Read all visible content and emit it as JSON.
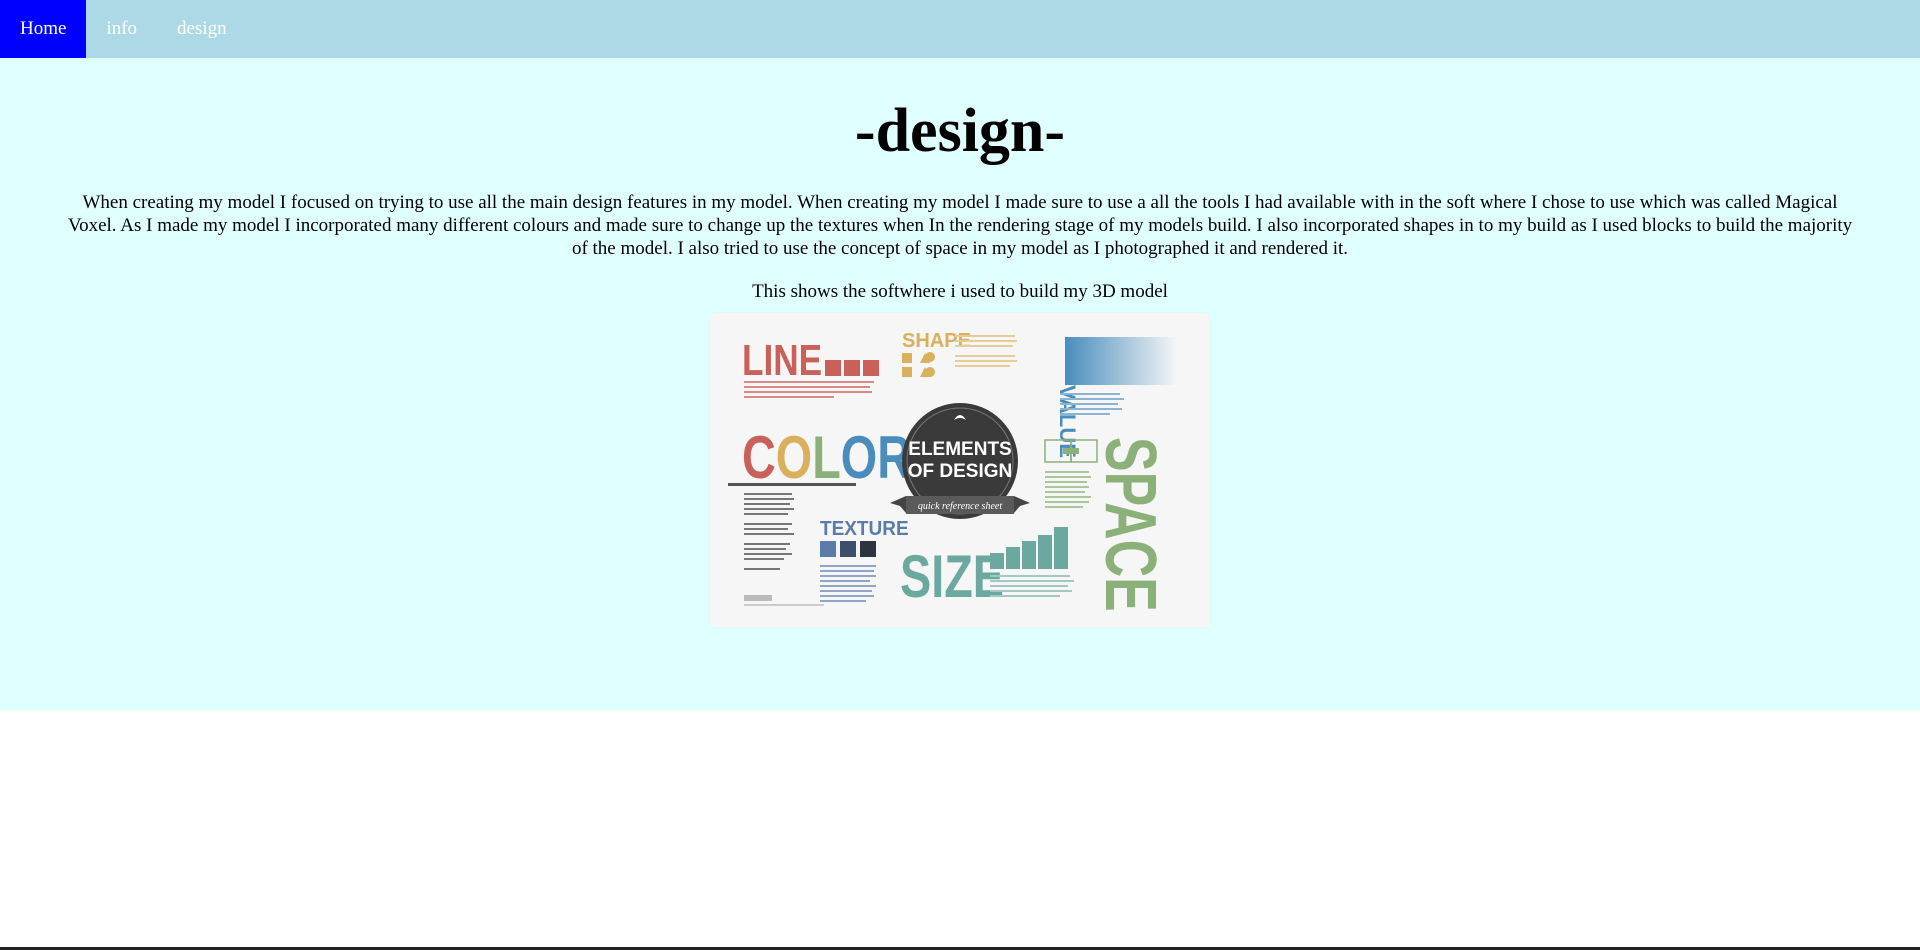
{
  "nav": {
    "items": [
      "Home",
      "info",
      "design"
    ],
    "active_index": 0
  },
  "main": {
    "title": "-design-",
    "paragraph": "When creating my model I focused on trying to use all the main design features in my model. When creating my model I made sure to use a all the tools I had available with in the soft where I chose to use which was called Magical Voxel. As I made my model I incorporated many different colours and made sure to change up the textures when In the rendering stage of my models build. I also incorporated shapes in to my build as I used blocks to build the majority of the model. I also tried to use the concept of space in my model as I photographed it and rendered it.",
    "image_caption": "This shows the softwhere i used to build my 3D model"
  },
  "poster": {
    "labels": {
      "line": "LINE",
      "shape": "SHAPE",
      "value": "VALUE",
      "color": "COLOR",
      "badge_line1": "ELEMENTS",
      "badge_line2": "OF DESIGN",
      "ribbon": "quick reference sheet",
      "texture": "TEXTURE",
      "size": "SIZE",
      "space": "SPACE"
    },
    "colors": {
      "line": "#c9605a",
      "shape": "#d9b05c",
      "value": "#4a8dbd",
      "color_c": "#c9605a",
      "color_o1": "#d9b05c",
      "color_l": "#8bb07a",
      "color_o2": "#4a8dbd",
      "color_r": "#4a8dbd",
      "badge": "#3a3a3a",
      "texture": "#5b7ba8",
      "size": "#6aa8a0",
      "space": "#8bb07a"
    }
  }
}
